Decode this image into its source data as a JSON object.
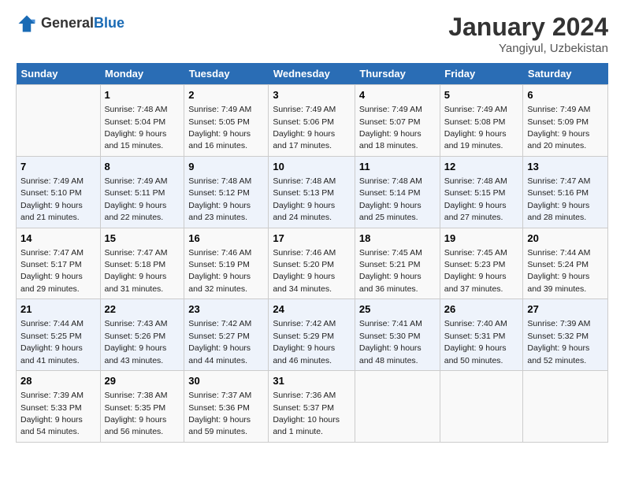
{
  "header": {
    "logo_general": "General",
    "logo_blue": "Blue",
    "title": "January 2024",
    "subtitle": "Yangiyul, Uzbekistan"
  },
  "days_of_week": [
    "Sunday",
    "Monday",
    "Tuesday",
    "Wednesday",
    "Thursday",
    "Friday",
    "Saturday"
  ],
  "weeks": [
    [
      {
        "day": "",
        "sunrise": "",
        "sunset": "",
        "daylight": ""
      },
      {
        "day": "1",
        "sunrise": "Sunrise: 7:48 AM",
        "sunset": "Sunset: 5:04 PM",
        "daylight": "Daylight: 9 hours and 15 minutes."
      },
      {
        "day": "2",
        "sunrise": "Sunrise: 7:49 AM",
        "sunset": "Sunset: 5:05 PM",
        "daylight": "Daylight: 9 hours and 16 minutes."
      },
      {
        "day": "3",
        "sunrise": "Sunrise: 7:49 AM",
        "sunset": "Sunset: 5:06 PM",
        "daylight": "Daylight: 9 hours and 17 minutes."
      },
      {
        "day": "4",
        "sunrise": "Sunrise: 7:49 AM",
        "sunset": "Sunset: 5:07 PM",
        "daylight": "Daylight: 9 hours and 18 minutes."
      },
      {
        "day": "5",
        "sunrise": "Sunrise: 7:49 AM",
        "sunset": "Sunset: 5:08 PM",
        "daylight": "Daylight: 9 hours and 19 minutes."
      },
      {
        "day": "6",
        "sunrise": "Sunrise: 7:49 AM",
        "sunset": "Sunset: 5:09 PM",
        "daylight": "Daylight: 9 hours and 20 minutes."
      }
    ],
    [
      {
        "day": "7",
        "sunrise": "Sunrise: 7:49 AM",
        "sunset": "Sunset: 5:10 PM",
        "daylight": "Daylight: 9 hours and 21 minutes."
      },
      {
        "day": "8",
        "sunrise": "Sunrise: 7:49 AM",
        "sunset": "Sunset: 5:11 PM",
        "daylight": "Daylight: 9 hours and 22 minutes."
      },
      {
        "day": "9",
        "sunrise": "Sunrise: 7:48 AM",
        "sunset": "Sunset: 5:12 PM",
        "daylight": "Daylight: 9 hours and 23 minutes."
      },
      {
        "day": "10",
        "sunrise": "Sunrise: 7:48 AM",
        "sunset": "Sunset: 5:13 PM",
        "daylight": "Daylight: 9 hours and 24 minutes."
      },
      {
        "day": "11",
        "sunrise": "Sunrise: 7:48 AM",
        "sunset": "Sunset: 5:14 PM",
        "daylight": "Daylight: 9 hours and 25 minutes."
      },
      {
        "day": "12",
        "sunrise": "Sunrise: 7:48 AM",
        "sunset": "Sunset: 5:15 PM",
        "daylight": "Daylight: 9 hours and 27 minutes."
      },
      {
        "day": "13",
        "sunrise": "Sunrise: 7:47 AM",
        "sunset": "Sunset: 5:16 PM",
        "daylight": "Daylight: 9 hours and 28 minutes."
      }
    ],
    [
      {
        "day": "14",
        "sunrise": "Sunrise: 7:47 AM",
        "sunset": "Sunset: 5:17 PM",
        "daylight": "Daylight: 9 hours and 29 minutes."
      },
      {
        "day": "15",
        "sunrise": "Sunrise: 7:47 AM",
        "sunset": "Sunset: 5:18 PM",
        "daylight": "Daylight: 9 hours and 31 minutes."
      },
      {
        "day": "16",
        "sunrise": "Sunrise: 7:46 AM",
        "sunset": "Sunset: 5:19 PM",
        "daylight": "Daylight: 9 hours and 32 minutes."
      },
      {
        "day": "17",
        "sunrise": "Sunrise: 7:46 AM",
        "sunset": "Sunset: 5:20 PM",
        "daylight": "Daylight: 9 hours and 34 minutes."
      },
      {
        "day": "18",
        "sunrise": "Sunrise: 7:45 AM",
        "sunset": "Sunset: 5:21 PM",
        "daylight": "Daylight: 9 hours and 36 minutes."
      },
      {
        "day": "19",
        "sunrise": "Sunrise: 7:45 AM",
        "sunset": "Sunset: 5:23 PM",
        "daylight": "Daylight: 9 hours and 37 minutes."
      },
      {
        "day": "20",
        "sunrise": "Sunrise: 7:44 AM",
        "sunset": "Sunset: 5:24 PM",
        "daylight": "Daylight: 9 hours and 39 minutes."
      }
    ],
    [
      {
        "day": "21",
        "sunrise": "Sunrise: 7:44 AM",
        "sunset": "Sunset: 5:25 PM",
        "daylight": "Daylight: 9 hours and 41 minutes."
      },
      {
        "day": "22",
        "sunrise": "Sunrise: 7:43 AM",
        "sunset": "Sunset: 5:26 PM",
        "daylight": "Daylight: 9 hours and 43 minutes."
      },
      {
        "day": "23",
        "sunrise": "Sunrise: 7:42 AM",
        "sunset": "Sunset: 5:27 PM",
        "daylight": "Daylight: 9 hours and 44 minutes."
      },
      {
        "day": "24",
        "sunrise": "Sunrise: 7:42 AM",
        "sunset": "Sunset: 5:29 PM",
        "daylight": "Daylight: 9 hours and 46 minutes."
      },
      {
        "day": "25",
        "sunrise": "Sunrise: 7:41 AM",
        "sunset": "Sunset: 5:30 PM",
        "daylight": "Daylight: 9 hours and 48 minutes."
      },
      {
        "day": "26",
        "sunrise": "Sunrise: 7:40 AM",
        "sunset": "Sunset: 5:31 PM",
        "daylight": "Daylight: 9 hours and 50 minutes."
      },
      {
        "day": "27",
        "sunrise": "Sunrise: 7:39 AM",
        "sunset": "Sunset: 5:32 PM",
        "daylight": "Daylight: 9 hours and 52 minutes."
      }
    ],
    [
      {
        "day": "28",
        "sunrise": "Sunrise: 7:39 AM",
        "sunset": "Sunset: 5:33 PM",
        "daylight": "Daylight: 9 hours and 54 minutes."
      },
      {
        "day": "29",
        "sunrise": "Sunrise: 7:38 AM",
        "sunset": "Sunset: 5:35 PM",
        "daylight": "Daylight: 9 hours and 56 minutes."
      },
      {
        "day": "30",
        "sunrise": "Sunrise: 7:37 AM",
        "sunset": "Sunset: 5:36 PM",
        "daylight": "Daylight: 9 hours and 59 minutes."
      },
      {
        "day": "31",
        "sunrise": "Sunrise: 7:36 AM",
        "sunset": "Sunset: 5:37 PM",
        "daylight": "Daylight: 10 hours and 1 minute."
      },
      {
        "day": "",
        "sunrise": "",
        "sunset": "",
        "daylight": ""
      },
      {
        "day": "",
        "sunrise": "",
        "sunset": "",
        "daylight": ""
      },
      {
        "day": "",
        "sunrise": "",
        "sunset": "",
        "daylight": ""
      }
    ]
  ]
}
